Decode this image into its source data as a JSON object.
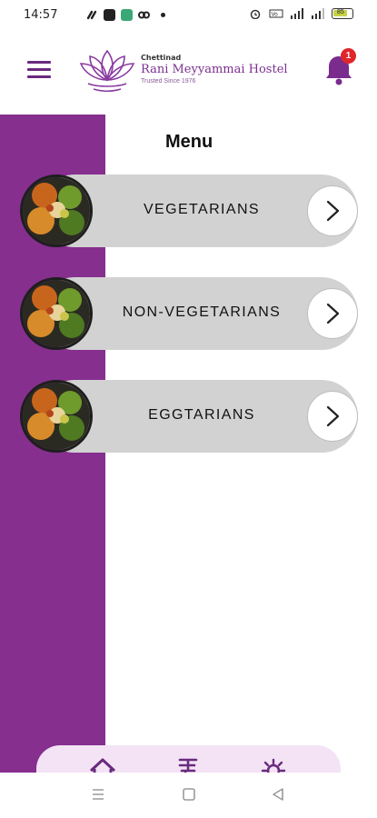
{
  "status_bar": {
    "time": "14:57",
    "battery": "85",
    "left_icons": [
      "link-icon",
      "app-icon",
      "app-green-icon",
      "link2-icon",
      "dot-icon"
    ],
    "right_icons": [
      "alarm-icon",
      "volte-icon",
      "signal-icon",
      "signal2-icon",
      "battery-icon"
    ]
  },
  "header": {
    "brand_small": "Chettinad",
    "brand_title": "Rani Meyyammai Hostel",
    "brand_tagline": "Trusted Since 1976",
    "notification_count": "1"
  },
  "page": {
    "title": "Menu"
  },
  "categories": [
    {
      "label": "VEGETARIANS"
    },
    {
      "label": "NON-VEGETARIANS"
    },
    {
      "label": "EGGTARIANS"
    }
  ],
  "bottom_nav": {
    "items": [
      "home-icon",
      "menu-book-icon",
      "settings-icon"
    ]
  },
  "colors": {
    "brand_purple": "#862f8f",
    "card_grey": "#d2d2d2",
    "badge_red": "#e0262b",
    "nav_bg": "#f3e3f5"
  }
}
